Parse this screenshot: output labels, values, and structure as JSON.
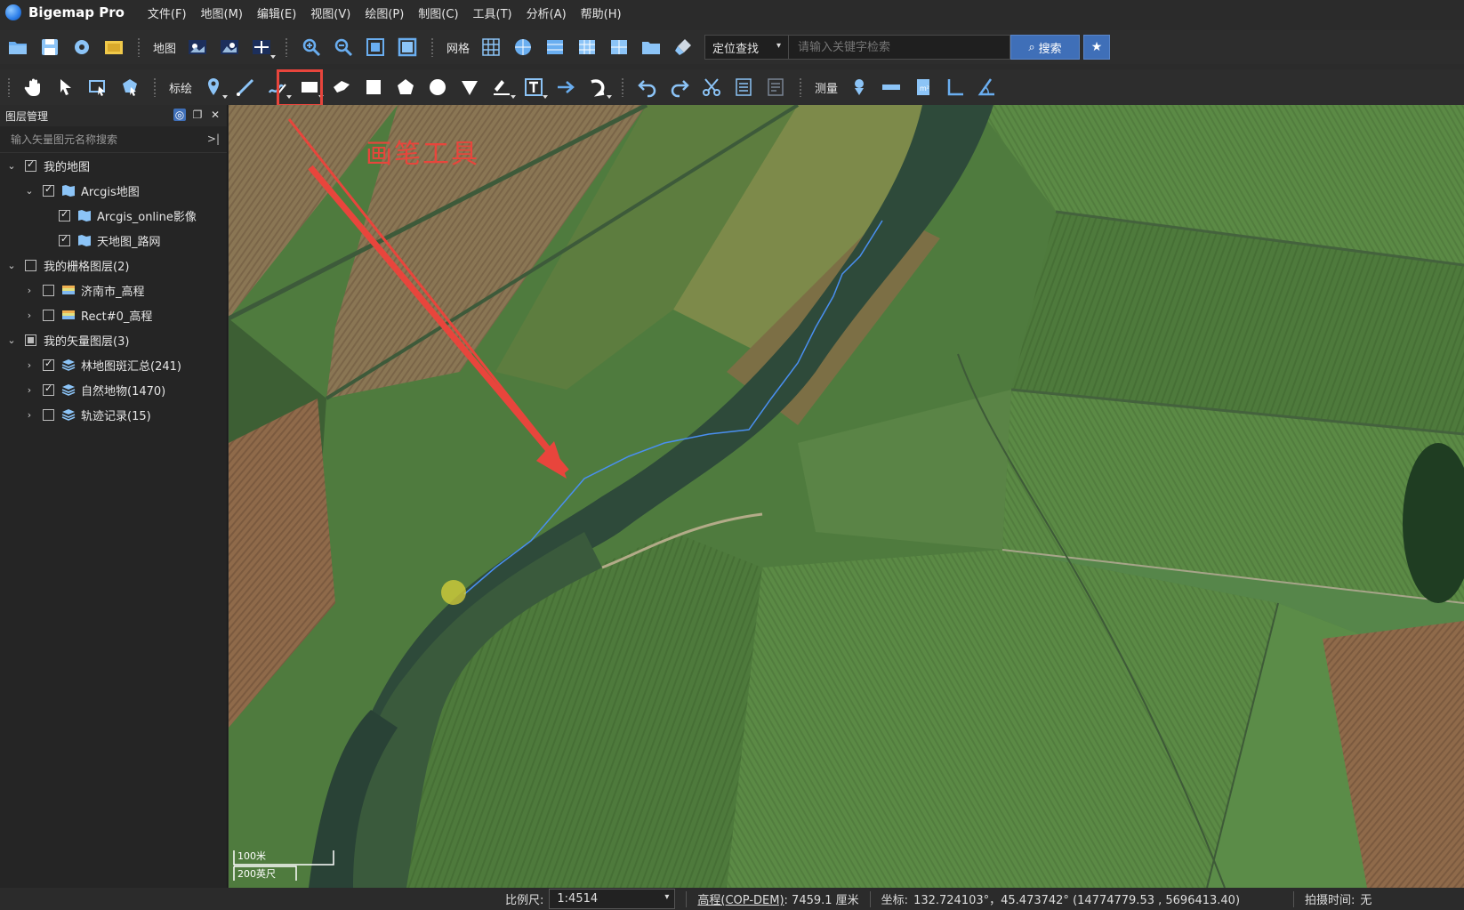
{
  "app": {
    "title": "Bigemap Pro"
  },
  "menu": [
    "文件(F)",
    "地图(M)",
    "编辑(E)",
    "视图(V)",
    "绘图(P)",
    "制图(C)",
    "工具(T)",
    "分析(A)",
    "帮助(H)"
  ],
  "toolbar1": {
    "map_label": "地图",
    "grid_label": "网格",
    "locate_select": "定位查找",
    "search_placeholder": "请输入关键字检索",
    "search_button": "搜索"
  },
  "toolbar2": {
    "draw_label": "标绘",
    "measure_label": "测量"
  },
  "layer_panel": {
    "title": "图层管理",
    "search_placeholder": "输入矢量图元名称搜索",
    "tree": [
      {
        "label": "我的地图",
        "level": 0,
        "expanded": true,
        "checked": "checked",
        "icon": "none"
      },
      {
        "label": "Arcgis地图",
        "level": 1,
        "expanded": true,
        "checked": "checked",
        "icon": "map-icon"
      },
      {
        "label": "Arcgis_online影像",
        "level": 2,
        "expanded": null,
        "checked": "checked",
        "icon": "map-icon"
      },
      {
        "label": "天地图_路网",
        "level": 2,
        "expanded": null,
        "checked": "checked",
        "icon": "map-icon"
      },
      {
        "label": "我的栅格图层(2)",
        "level": 0,
        "expanded": true,
        "checked": "unchecked",
        "icon": "none"
      },
      {
        "label": "济南市_高程",
        "level": 1,
        "expanded": false,
        "checked": "unchecked",
        "icon": "raster-icon"
      },
      {
        "label": "Rect#0_高程",
        "level": 1,
        "expanded": false,
        "checked": "unchecked",
        "icon": "raster-icon"
      },
      {
        "label": "我的矢量图层(3)",
        "level": 0,
        "expanded": true,
        "checked": "partial",
        "icon": "none"
      },
      {
        "label": "林地图斑汇总(241)",
        "level": 1,
        "expanded": false,
        "checked": "checked",
        "icon": "vector-icon"
      },
      {
        "label": "自然地物(1470)",
        "level": 1,
        "expanded": false,
        "checked": "checked",
        "icon": "vector-icon"
      },
      {
        "label": "轨迹记录(15)",
        "level": 1,
        "expanded": false,
        "checked": "unchecked",
        "icon": "vector-icon"
      }
    ]
  },
  "map": {
    "annotation": "画笔工具",
    "scale_bar_metric": "100米",
    "scale_bar_imperial": "200英尺"
  },
  "status": {
    "scale_label": "比例尺:",
    "scale_value": "1:4514",
    "elevation_link": "高程(COP-DEM)",
    "elevation_value": ": 7459.1 厘米",
    "coord_label": "坐标:",
    "coord_value": "132.724103°，45.473742°  (14774779.53 , 5696413.40)",
    "capture_label": "拍摄时间:",
    "capture_value": "无"
  },
  "colors": {
    "accent": "#3f6fb8",
    "highlight": "#e8453c"
  }
}
